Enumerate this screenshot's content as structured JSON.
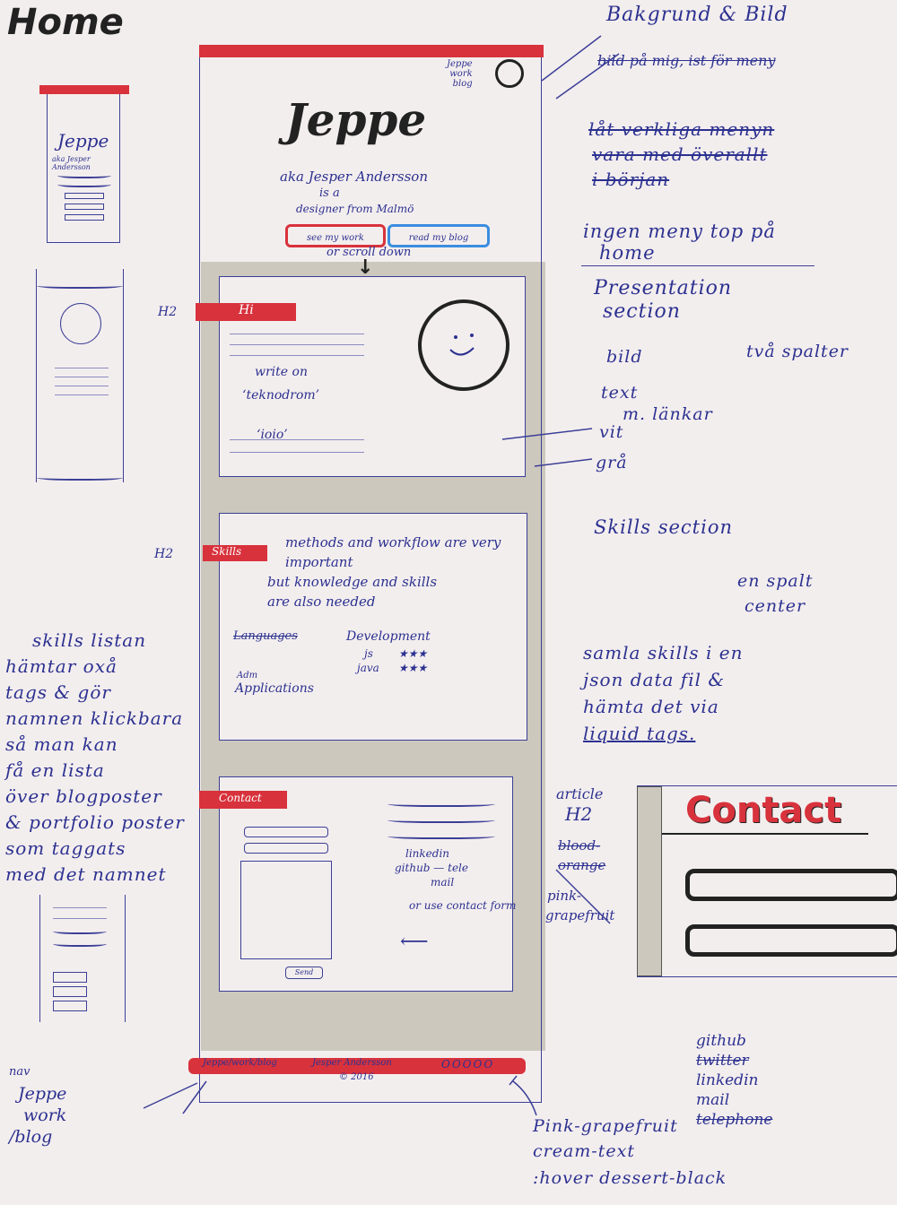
{
  "page": {
    "title": "Home"
  },
  "colors": {
    "ink": "#2c3190",
    "red": "#d8323c",
    "gray": "#ccc8bd",
    "blue": "#3a8de0",
    "black": "#222222"
  },
  "mockup": {
    "header_links": [
      "Jeppe",
      "work",
      "blog"
    ],
    "hero_name": "Jeppe",
    "hero_aka": "aka Jesper Andersson",
    "hero_is": "is a",
    "hero_role": "designer from Malmö",
    "btn_work": "see my work",
    "btn_blog": "read my blog",
    "scroll_hint": "or scroll down",
    "arrow_label": "↓",
    "h2_label": "H2",
    "hi_label": "Hi",
    "hi_lines": [
      "write on",
      "‘teknodrom’",
      "‘ioio’"
    ],
    "skills_label": "Skills",
    "skills_text": [
      "methods and workflow are very important",
      "but knowledge and skills",
      "are also needed"
    ],
    "skills_cols": {
      "languages": "Languages",
      "development": "Development",
      "js": "js",
      "java": "java",
      "applications": "Applications",
      "adm": "Adm"
    },
    "stars": [
      "★★★",
      "★★★"
    ],
    "contact_label": "Contact",
    "contact_links": [
      "linkedin",
      "github",
      "tele",
      "mail",
      "or use contact form"
    ],
    "send_label": "Send",
    "footer_left": "Jeppe/work/blog",
    "footer_mid": "Jesper Andersson",
    "footer_year": "© 2016",
    "footer_icons": "OOOOO"
  },
  "notes": {
    "bakgrund": "Bakgrund & Bild",
    "bild_pa": "bild på mig, ist för meny",
    "lat": "låt verkliga menyn",
    "vara": "vara med överallt",
    "borjan": "i början",
    "ingen": "ingen meny top på",
    "home": "home",
    "presentation": "Presentation",
    "section": "section",
    "bild": "bild",
    "tva": "två spalter",
    "text": "text",
    "lankar": "m. länkar",
    "vit": "vit",
    "gra": "grå",
    "skills_section": "Skills section",
    "en_spalt": "en spalt",
    "center": "center",
    "samla": "samla skills i en",
    "json": "json data fil &",
    "hamta": "hämta det via",
    "liquid": "liquid tags.",
    "article": "article",
    "h2": "H2",
    "blood": "blood-",
    "orange": "orange",
    "pink": "pink-",
    "grapefruit": "grapefruit",
    "contact_big": "Contact",
    "footer_icons_list": [
      "github",
      "twitter",
      "linkedin",
      "mail",
      "telephone"
    ],
    "pink_grapefruit": "Pink-grapefruit",
    "cream_text": "cream-text",
    "hover": ":hover dessert-black",
    "nav": "nav",
    "jeppe": "Jeppe",
    "work": "work",
    "blog": "/blog",
    "skills_left": [
      "skills listan",
      "hämtar oxå",
      "tags & gör",
      "namnen klickbara",
      "så man kan",
      "få en lista",
      "över blogposter",
      "& portfolio poster",
      "som taggats",
      "med det namnet"
    ]
  },
  "thumb": {
    "name": "Jeppe",
    "sub": "aka Jesper Andersson"
  }
}
